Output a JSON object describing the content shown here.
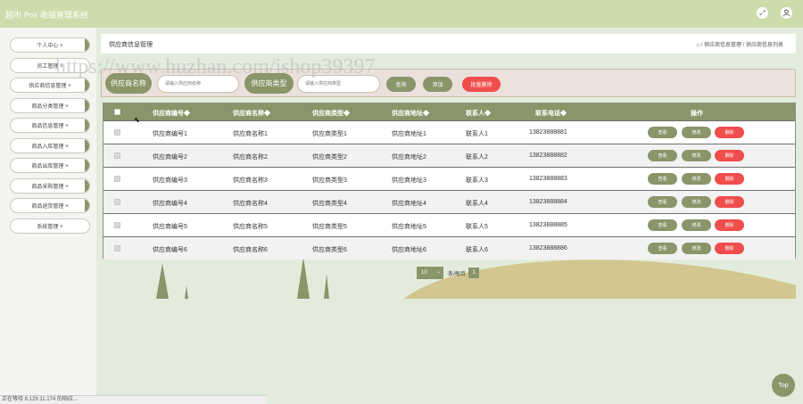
{
  "app": {
    "title": "超市 Pos 收银管理系统"
  },
  "header_icons": [
    "fullscreen-icon",
    "user-icon"
  ],
  "sidebar": {
    "items": [
      {
        "label": "个人中心 ˅"
      },
      {
        "label": "员工管理 ˅"
      },
      {
        "label": "供应商信息管理 ˅"
      },
      {
        "label": "商品分类管理 ˅"
      },
      {
        "label": "商品信息管理 ˅"
      },
      {
        "label": "商品入库管理 ˅"
      },
      {
        "label": "商品出库管理 ˅"
      },
      {
        "label": "商品采购管理 ˅"
      },
      {
        "label": "商品退货管理 ˅"
      },
      {
        "label": "系统管理 ˅"
      }
    ]
  },
  "page": {
    "title": "供应商信息管理",
    "breadcrumb": "/ 供应商信息管理 / 供应商信息列表"
  },
  "search": {
    "name_label": "供应商名称",
    "name_placeholder": "请输入供应商名称",
    "type_label": "供应商类型",
    "type_placeholder": "请输入供应商类型",
    "query_btn": "查询",
    "add_btn": "添加",
    "batch_delete_btn": "批量删除"
  },
  "table": {
    "headers": [
      "供应商编号◆",
      "供应商名称◆",
      "供应商类型◆",
      "供应商地址◆",
      "联系人◆",
      "联系电话◆",
      "操作"
    ],
    "rows": [
      {
        "code": "供应商编号1",
        "name": "供应商名称1",
        "type": "供应商类型1",
        "address": "供应商地址1",
        "contact": "联系人1",
        "phone": "13823888881"
      },
      {
        "code": "供应商编号2",
        "name": "供应商名称2",
        "type": "供应商类型2",
        "address": "供应商地址2",
        "contact": "联系人2",
        "phone": "13823888882"
      },
      {
        "code": "供应商编号3",
        "name": "供应商名称3",
        "type": "供应商类型3",
        "address": "供应商地址3",
        "contact": "联系人3",
        "phone": "13823888883"
      },
      {
        "code": "供应商编号4",
        "name": "供应商名称4",
        "type": "供应商类型4",
        "address": "供应商地址4",
        "contact": "联系人4",
        "phone": "13823888884"
      },
      {
        "code": "供应商编号5",
        "name": "供应商名称5",
        "type": "供应商类型5",
        "address": "供应商地址5",
        "contact": "联系人5",
        "phone": "13823888885"
      },
      {
        "code": "供应商编号6",
        "name": "供应商名称6",
        "type": "供应商类型6",
        "address": "供应商地址6",
        "contact": "联系人6",
        "phone": "13823888886"
      }
    ],
    "actions": {
      "view": "查看",
      "edit": "修改",
      "delete": "删除"
    }
  },
  "pagination": {
    "page_size": "10",
    "per_page_label": "条/每页",
    "current_page": "1"
  },
  "status_bar": "正在等待 8.129.11.174 的响应...",
  "top_button": "Top",
  "watermark": "https://www.huzhan.com/ishop39397",
  "colors": {
    "olive": "#8a956a",
    "topbar": "#cddcab",
    "danger": "#f04d4d",
    "background": "#e3ecdc"
  }
}
